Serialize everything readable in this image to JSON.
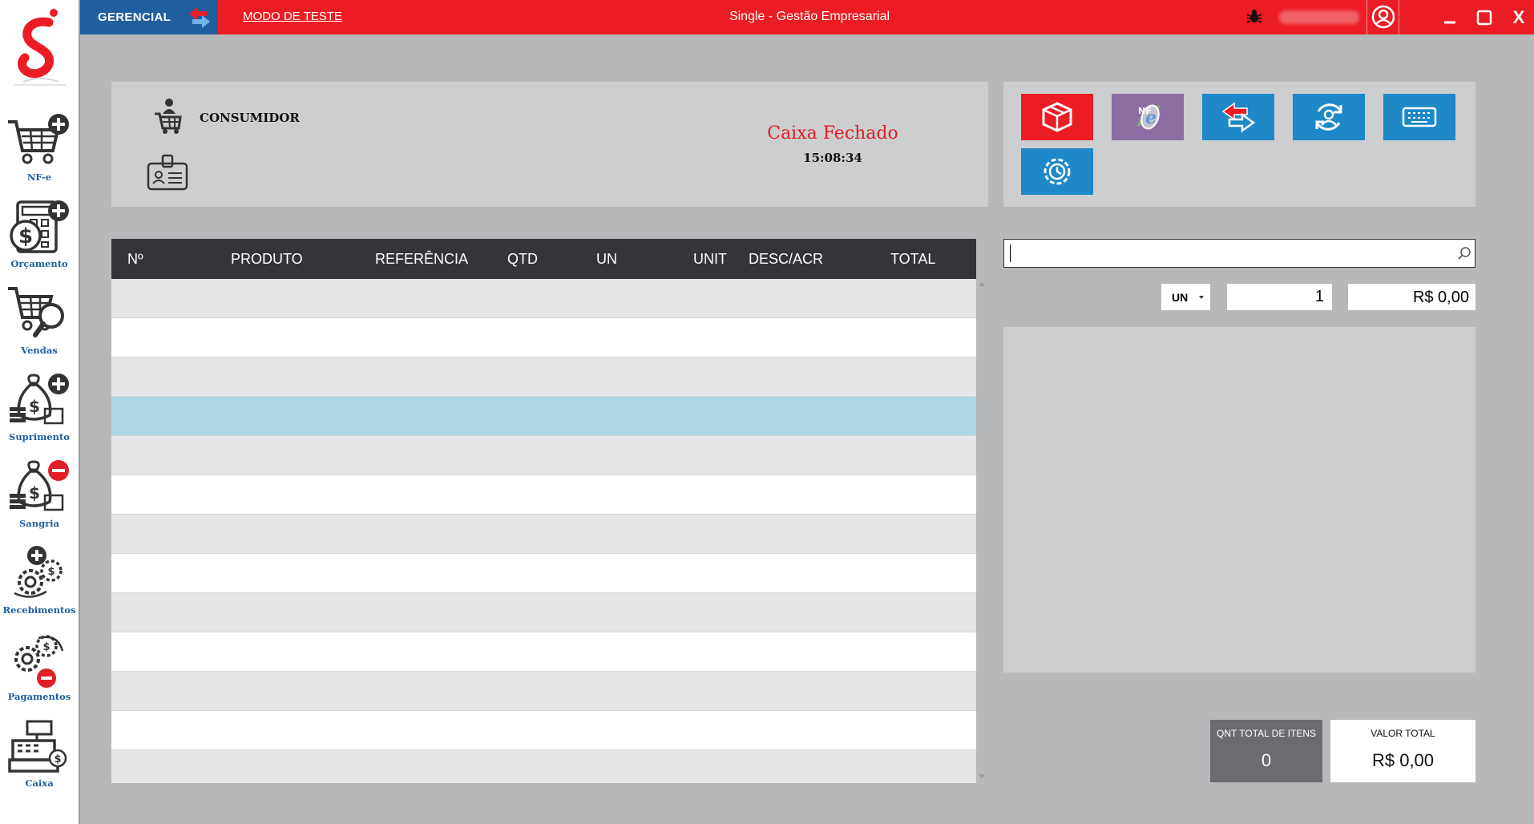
{
  "titlebar": {
    "mode_label": "GERENCIAL",
    "test_mode_link": "MODO DE TESTE",
    "app_title": "Single - Gestão Empresarial",
    "minimize_icon": "minimize-icon",
    "maximize_icon": "maximize-icon",
    "close_label": "X",
    "accent_color": "#ec1c24",
    "mode_color": "#1f5f9e"
  },
  "sidebar": {
    "items": [
      {
        "label": "NF-e",
        "icon": "cart-plus-icon"
      },
      {
        "label": "Orçamento",
        "icon": "calculator-money-icon"
      },
      {
        "label": "Vendas",
        "icon": "cart-search-icon"
      },
      {
        "label": "Suprimento",
        "icon": "money-bag-plus-icon"
      },
      {
        "label": "Sangria",
        "icon": "money-bag-minus-icon"
      },
      {
        "label": "Recebimentos",
        "icon": "gears-plus-icon"
      },
      {
        "label": "Pagamentos",
        "icon": "gears-minus-icon"
      },
      {
        "label": "Caixa",
        "icon": "cash-register-icon"
      }
    ],
    "label_color": "#1f5f9e"
  },
  "client": {
    "name": "CONSUMIDOR",
    "caixa_status": "Caixa Fechado",
    "time": "15:08:34",
    "status_color": "#e01e26"
  },
  "actions": [
    {
      "name": "product-button",
      "icon": "box-icon",
      "color": "#ec1c24"
    },
    {
      "name": "nfe-button",
      "icon": "nfe-logo-icon",
      "color": "#8d6ea3"
    },
    {
      "name": "exchange-button",
      "icon": "exchange-arrows-icon",
      "color": "#1e88c9"
    },
    {
      "name": "customer-refresh-button",
      "icon": "user-refresh-icon",
      "color": "#1e88c9"
    },
    {
      "name": "keyboard-button",
      "icon": "keyboard-icon",
      "color": "#1e88c9"
    },
    {
      "name": "settings-button",
      "icon": "gear-clock-icon",
      "color": "#1e88c9"
    }
  ],
  "table": {
    "columns": [
      "Nº",
      "PRODUTO",
      "REFERÊNCIA",
      "QTD",
      "UN",
      "UNIT",
      "DESC/ACR",
      "TOTAL"
    ],
    "rows": [],
    "selected_row_color": "#acd8e6"
  },
  "search": {
    "value": "",
    "placeholder": ""
  },
  "entry": {
    "unit": "UN",
    "quantity": "1",
    "price": "R$ 0,00"
  },
  "totals": {
    "qty_label": "QNT TOTAL DE ITENS",
    "qty_value": "0",
    "value_label": "VALOR TOTAL",
    "value_value": "R$ 0,00"
  }
}
